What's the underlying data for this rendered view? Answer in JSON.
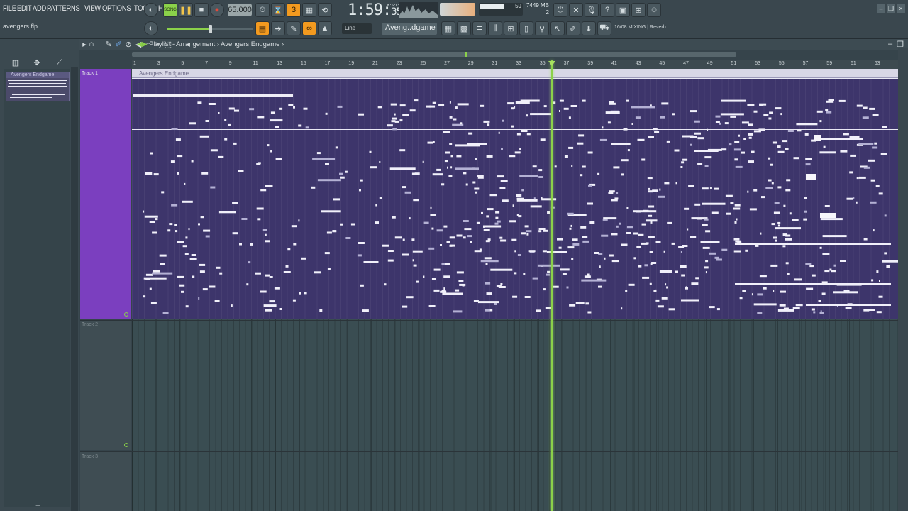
{
  "menu": [
    "FILE",
    "EDIT",
    "ADD",
    "PATTERNS",
    "VIEW",
    "OPTIONS",
    "TOOLS",
    "HELP"
  ],
  "project_file": "avengers.flp",
  "song_badge": "SONG",
  "tempo": "65.000",
  "time": "1:59",
  "time_sub": "35",
  "time_unit": "M:S:CS",
  "cpu_value": "59",
  "memory": "7449 MB",
  "poly": "2",
  "snap_mode": "Line",
  "pattern_name": "Aveng..dgame",
  "hint_text": "16/08  MIXING | Reverb",
  "breadcrumb": {
    "root": "Playlist - Arrangement",
    "child": "Avengers Endgame"
  },
  "browser_clip": "Avengers Endgame",
  "clip_title": "Avengers Endgame",
  "tracks": [
    "Track 1",
    "Track 2",
    "Track 3"
  ],
  "ruler": [
    "1",
    "3",
    "5",
    "7",
    "9",
    "11",
    "13",
    "15",
    "17",
    "19",
    "21",
    "23",
    "25",
    "27",
    "29",
    "31",
    "33",
    "35",
    "37",
    "39",
    "41",
    "43",
    "45",
    "47",
    "49",
    "51",
    "53",
    "55",
    "57",
    "59",
    "61",
    "63"
  ],
  "colors": {
    "accent": "#f39a1f",
    "clip_bg": "#3d356b",
    "playhead": "#8bd14a",
    "track1": "#7b3fbf"
  }
}
